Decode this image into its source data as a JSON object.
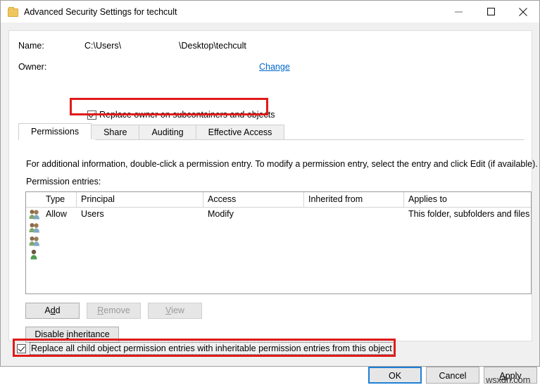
{
  "window": {
    "title": "Advanced Security Settings for techcult",
    "icon": "folder-icon",
    "caption_buttons": {
      "minimize": "minimize-icon",
      "maximize": "maximize-icon",
      "close": "close-icon"
    }
  },
  "header": {
    "name_label": "Name:",
    "name_value_prefix": "C:\\Users\\",
    "name_value_suffix": "\\Desktop\\techcult",
    "owner_label": "Owner:",
    "owner_value": "",
    "change_link_accel": "C",
    "change_link_rest": "hange",
    "replace_owner_checkbox": {
      "label": "Replace owner on subcontainers and objects",
      "checked": true,
      "highlighted": true
    }
  },
  "tabs": [
    {
      "label": "Permissions",
      "active": true
    },
    {
      "label": "Share",
      "active": false
    },
    {
      "label": "Auditing",
      "active": false
    },
    {
      "label": "Effective Access",
      "active": false
    }
  ],
  "main": {
    "description": "For additional information, double-click a permission entry. To modify a permission entry, select the entry and click Edit (if available).",
    "entries_label": "Permission entries:",
    "table": {
      "columns": [
        "",
        "Type",
        "Principal",
        "Access",
        "Inherited from",
        "Applies to"
      ],
      "rows": [
        {
          "icon": "group-icon",
          "type": "Allow",
          "principal": "Users",
          "access": "Modify",
          "inherited_from": "",
          "applies_to": "This folder, subfolders and files"
        },
        {
          "icon": "group-icon",
          "type": "",
          "principal": "",
          "access": "",
          "inherited_from": "",
          "applies_to": ""
        },
        {
          "icon": "group-icon",
          "type": "",
          "principal": "",
          "access": "",
          "inherited_from": "",
          "applies_to": ""
        },
        {
          "icon": "user-icon",
          "type": "",
          "principal": "",
          "access": "",
          "inherited_from": "",
          "applies_to": ""
        }
      ]
    },
    "buttons": {
      "add": {
        "accel": "d",
        "before": "A",
        "after": "d",
        "label": "Add",
        "enabled": true
      },
      "remove": {
        "label": "Remove",
        "accel": "R",
        "after": "emove",
        "enabled": false
      },
      "view": {
        "label": "View",
        "accel": "V",
        "after": "iew",
        "enabled": false
      },
      "disable_inheritance": {
        "label": "Disable inheritance",
        "before": "Disable ",
        "accel": "i",
        "after": "nheritance",
        "enabled": true
      }
    },
    "replace_child_checkbox": {
      "label": "Replace all child object permission entries with inheritable permission entries from this object",
      "checked": true,
      "focused": true,
      "highlighted": true
    }
  },
  "footer": {
    "ok": "OK",
    "cancel": "Cancel",
    "apply_accel": "A",
    "apply_rest": "pply",
    "apply_label": "Apply"
  },
  "watermark": "wsxdn.com",
  "colors": {
    "highlight_red": "#e01b1b",
    "link_blue": "#0066cc",
    "focus_blue": "#1c7fd6",
    "window_bg": "#f0f0f0",
    "panel_bg": "#ffffff"
  }
}
